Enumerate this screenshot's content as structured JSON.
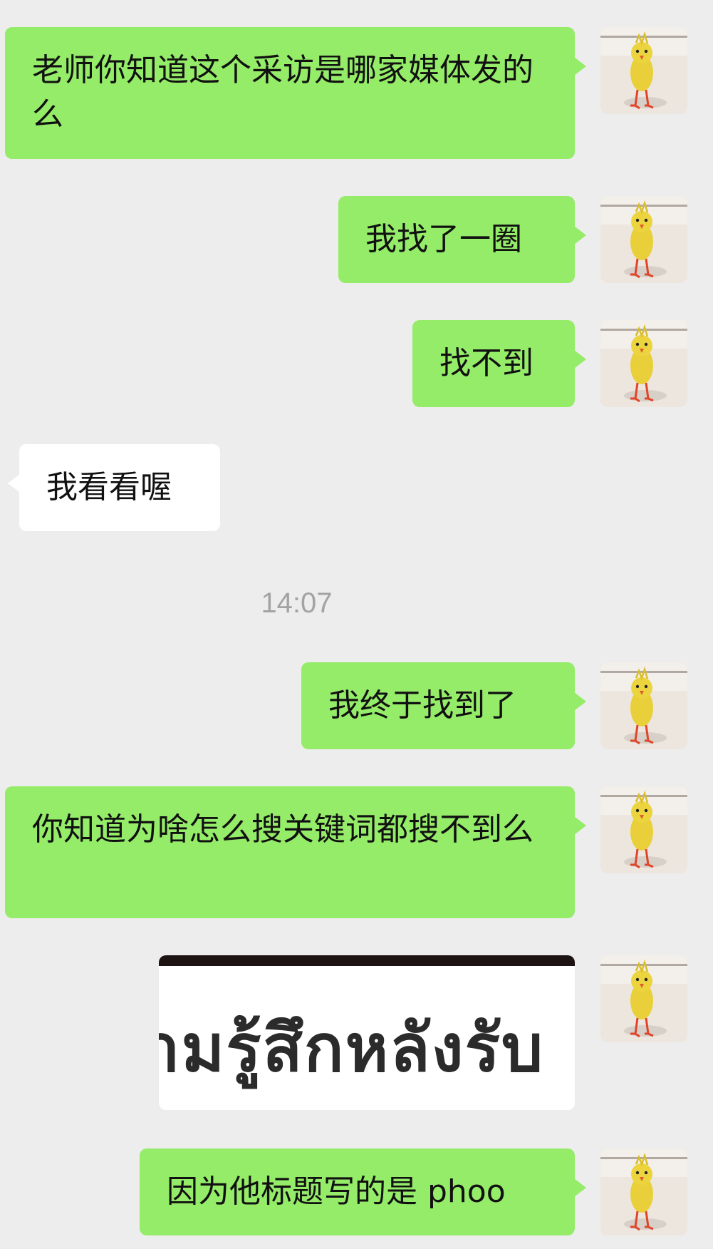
{
  "messages": [
    {
      "side": "sent",
      "text": "老师你知道这个采访是哪家媒体发的么"
    },
    {
      "side": "sent",
      "text": "我找了一圈"
    },
    {
      "side": "sent",
      "text": "找不到"
    },
    {
      "side": "received",
      "text": "我看看喔"
    },
    {
      "timestamp": "14:07"
    },
    {
      "side": "sent",
      "text": "我终于找到了"
    },
    {
      "side": "sent",
      "text": "你知道为啥怎么搜关键词都搜不到么"
    },
    {
      "side": "sent",
      "type": "image",
      "image_text": "ามรู้สึกหลังรับ"
    },
    {
      "side": "sent",
      "text": "因为他标题写的是 phoo"
    }
  ],
  "colors": {
    "background": "#ededed",
    "sent_bubble": "#95ec69",
    "received_bubble": "#ffffff",
    "timestamp": "#a3a3a3"
  },
  "avatar": {
    "icon": "yellow-chick-avatar-icon"
  }
}
